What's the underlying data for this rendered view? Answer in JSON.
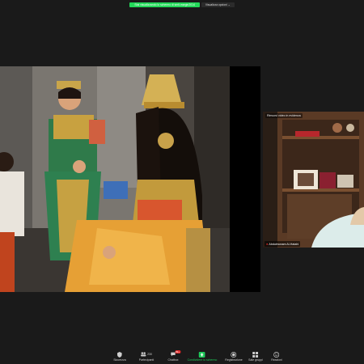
{
  "banner": {
    "share_label": "Stai visualizzando lo schermo di smit-margin2014",
    "options_label": "Visualizza opzioni ⌄"
  },
  "video_tile": {
    "overlay_label": "Rimuovi video in evidenza",
    "participant_name": "Abdulmonam Al-Hatahi"
  },
  "toolbar": {
    "security": "Sicurezza",
    "participants": "Partecipanti",
    "participants_count": "230",
    "chat": "Chatbox",
    "chat_badge": "99+",
    "share": "Condividere lo schermo",
    "record": "Registrazione",
    "rooms": "Sale gruppi",
    "reactions": "Reazioni"
  },
  "colors": {
    "share_green": "#23d959",
    "chat_badge_red": "#e02828"
  }
}
